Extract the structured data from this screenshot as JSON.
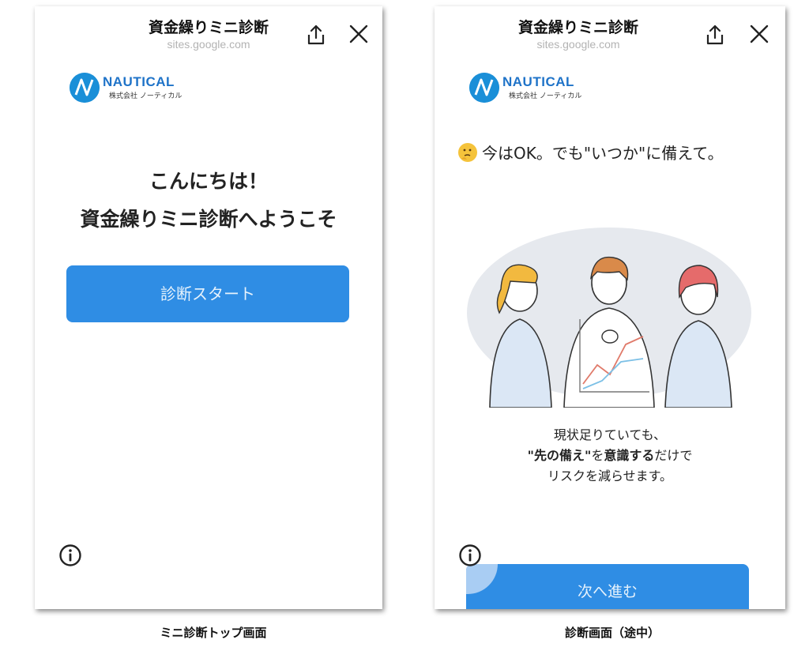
{
  "left_screen": {
    "site_title": "資金繰りミニ診断",
    "site_url": "sites.google.com",
    "logo": {
      "brand": "NAUTICAL",
      "company": "株式会社 ノーティカル"
    },
    "greeting_line1": "こんにちは！",
    "greeting_line2": "資金繰りミニ診断へようこそ",
    "start_button": "診断スタート",
    "caption": "ミニ診断トップ画面"
  },
  "right_screen": {
    "site_title": "資金繰りミニ診断",
    "site_url": "sites.google.com",
    "logo": {
      "brand": "NAUTICAL",
      "company": "株式会社 ノーティカル"
    },
    "question": "今はOK。でも\"いつか\"に備えて。",
    "desc_line1": "現状足りていても、",
    "desc_line2_bold1": "\"先の備え\"",
    "desc_line2_mid": "を",
    "desc_line2_bold2": "意識する",
    "desc_line2_tail": "だけで",
    "desc_line3": "リスクを減らせます。",
    "next_button": "次へ進む",
    "caption": "診断画面（途中）"
  },
  "icons": [
    "share-icon",
    "close-icon",
    "info-icon",
    "thinking-face-icon",
    "nautical-logo-icon"
  ],
  "colors": {
    "accent": "#2f8de4",
    "logo_blue": "#1a8fd8",
    "url_gray": "#b3b3b3"
  }
}
